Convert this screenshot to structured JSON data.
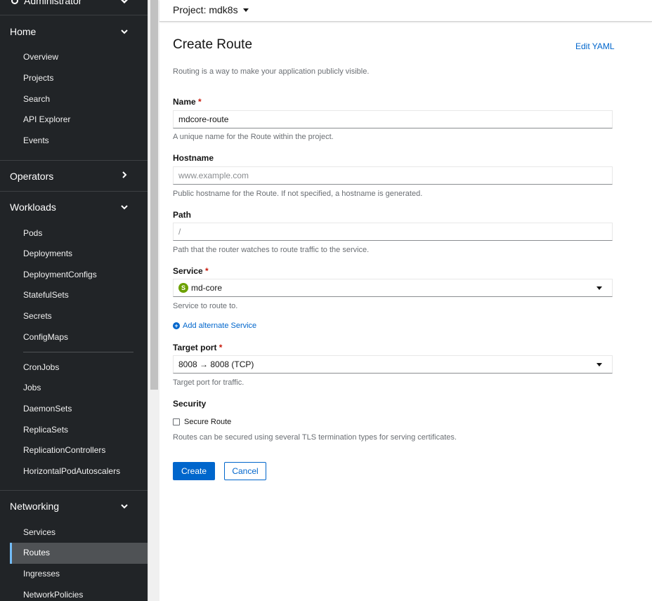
{
  "sidebar": {
    "perspective": "Administrator",
    "sections": [
      {
        "title": "Home",
        "expanded": true,
        "items": [
          "Overview",
          "Projects",
          "Search",
          "API Explorer",
          "Events"
        ]
      },
      {
        "title": "Operators",
        "expanded": false,
        "items": []
      },
      {
        "title": "Workloads",
        "expanded": true,
        "items": [
          "Pods",
          "Deployments",
          "DeploymentConfigs",
          "StatefulSets",
          "Secrets",
          "ConfigMaps",
          "CronJobs",
          "Jobs",
          "DaemonSets",
          "ReplicaSets",
          "ReplicationControllers",
          "HorizontalPodAutoscalers"
        ]
      },
      {
        "title": "Networking",
        "expanded": true,
        "items": [
          "Services",
          "Routes",
          "Ingresses",
          "NetworkPolicies"
        ]
      }
    ],
    "active_item": "Routes"
  },
  "topbar": {
    "project_label": "Project: mdk8s"
  },
  "form": {
    "title": "Create Route",
    "edit_yaml": "Edit YAML",
    "intro": "Routing is a way to make your application publicly visible.",
    "required_marker": "*",
    "name": {
      "label": "Name",
      "value": "mdcore-route",
      "helper": "A unique name for the Route within the project."
    },
    "hostname": {
      "label": "Hostname",
      "value": "",
      "placeholder": "www.example.com",
      "helper": "Public hostname for the Route. If not specified, a hostname is generated."
    },
    "path": {
      "label": "Path",
      "value": "",
      "placeholder": "/",
      "helper": "Path that the router watches to route traffic to the service."
    },
    "service": {
      "label": "Service",
      "badge": "S",
      "value": "md-core",
      "helper": "Service to route to."
    },
    "add_alternate": "Add alternate Service",
    "target_port": {
      "label": "Target port",
      "value": "8008 → 8008 (TCP)",
      "helper": "Target port for traffic."
    },
    "security": {
      "label": "Security",
      "checkbox_label": "Secure Route",
      "helper": "Routes can be secured using several TLS termination types for serving certificates."
    },
    "create_button": "Create",
    "cancel_button": "Cancel"
  },
  "colors": {
    "accent": "#0066cc",
    "sidebar_bg": "#212427",
    "service_badge": "#6ca100",
    "required": "#c9190b"
  }
}
